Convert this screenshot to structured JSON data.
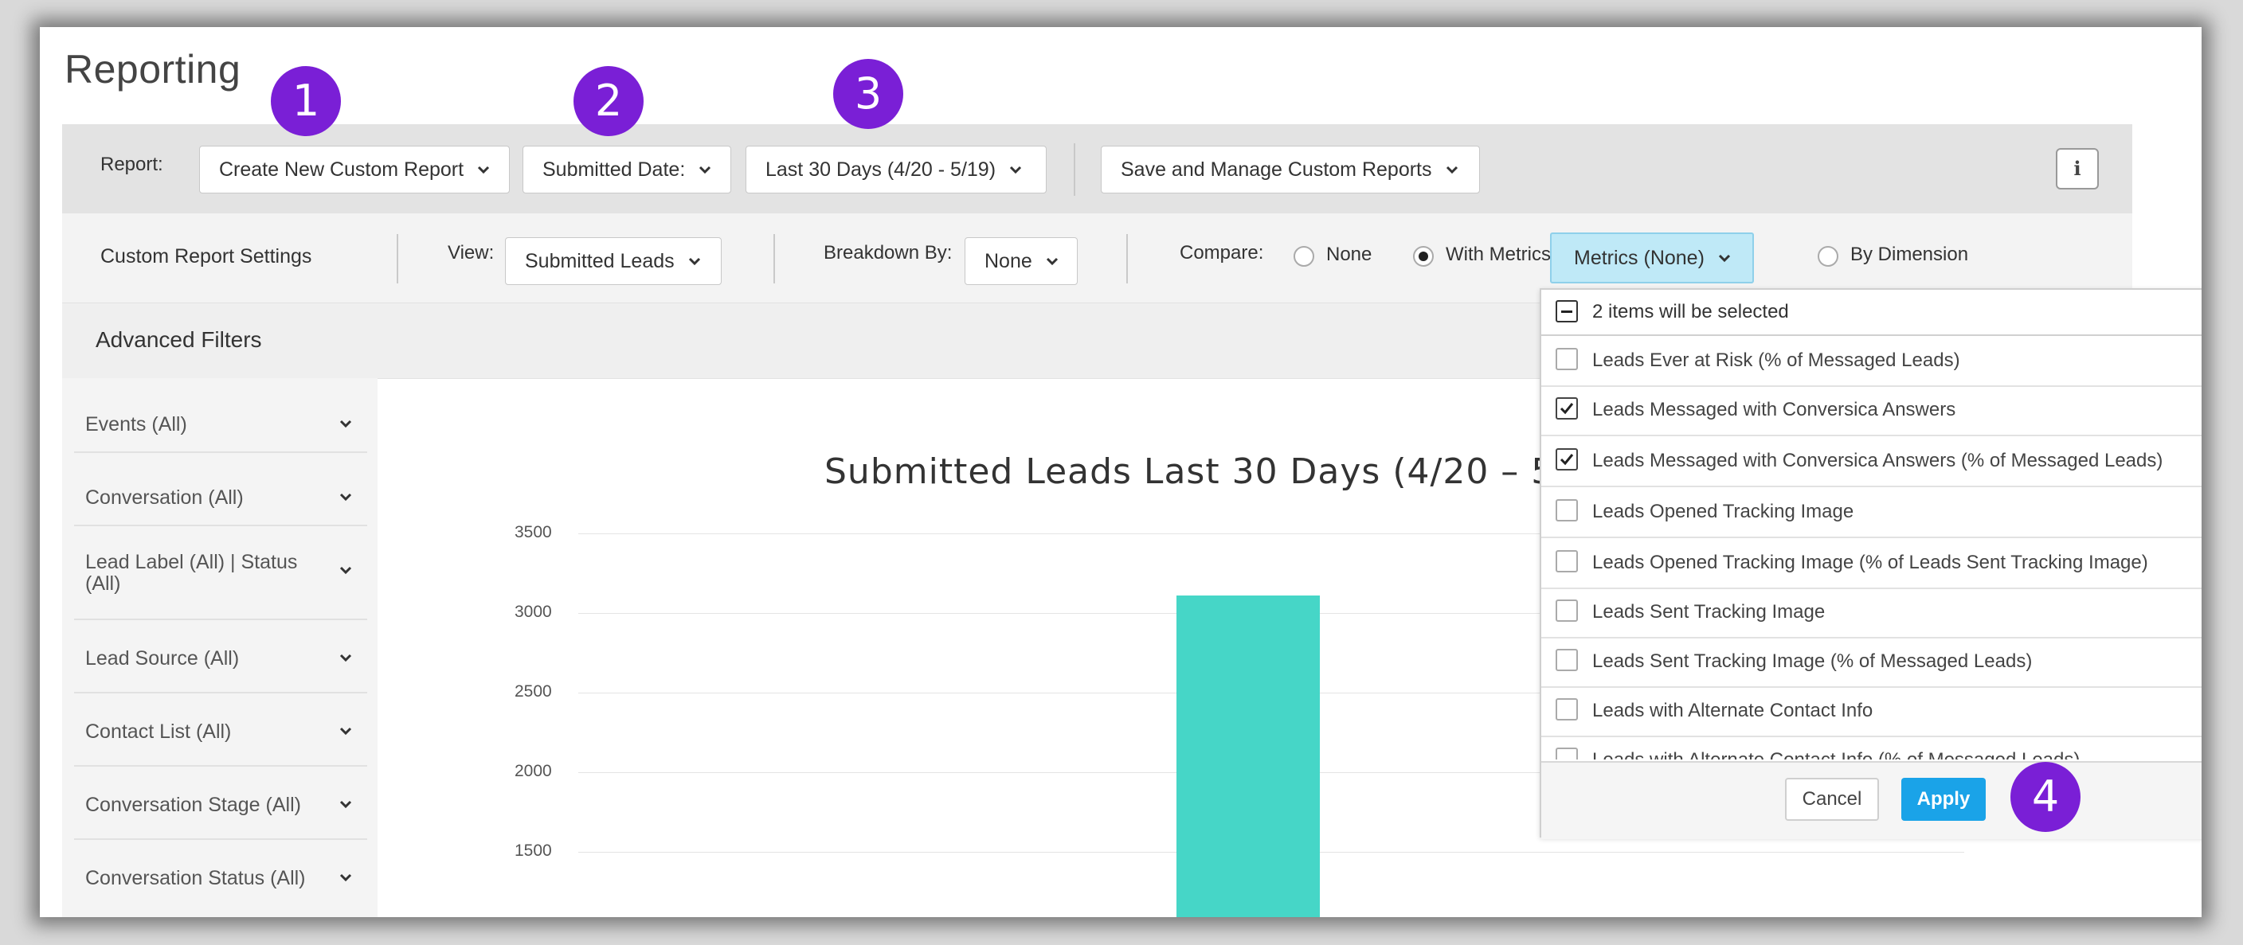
{
  "page": {
    "title": "Reporting"
  },
  "callouts": [
    "1",
    "2",
    "3",
    "4"
  ],
  "toolbar": {
    "report_label": "Report:",
    "report_select": "Create New Custom Report",
    "date_field_select": "Submitted Date:",
    "date_range_select": "Last 30 Days (4/20 - 5/19)",
    "save_manage_button": "Save and Manage Custom Reports",
    "info_icon": "i"
  },
  "settings": {
    "title": "Custom Report Settings",
    "view_label": "View:",
    "view_select": "Submitted Leads",
    "breakdown_label": "Breakdown By:",
    "breakdown_select": "None",
    "compare_label": "Compare:",
    "compare_options": [
      "None",
      "With Metrics",
      "By Dimension"
    ],
    "compare_selected": "With Metrics",
    "metrics_select": "Metrics (None)"
  },
  "filters": {
    "title": "Advanced Filters",
    "items": [
      "Events (All)",
      "Conversation (All)",
      "Lead Label (All) | Status (All)",
      "Lead Source (All)",
      "Contact List (All)",
      "Conversation Stage (All)",
      "Conversation Status (All)"
    ]
  },
  "metrics_dropdown": {
    "header": "2 items will be selected",
    "options": [
      {
        "label": "Leads Ever at Risk (% of Messaged Leads)",
        "checked": false
      },
      {
        "label": "Leads Messaged with Conversica Answers",
        "checked": true
      },
      {
        "label": "Leads Messaged with Conversica Answers (% of Messaged Leads)",
        "checked": true
      },
      {
        "label": "Leads Opened Tracking Image",
        "checked": false
      },
      {
        "label": "Leads Opened Tracking Image (% of Leads Sent Tracking Image)",
        "checked": false
      },
      {
        "label": "Leads Sent Tracking Image",
        "checked": false
      },
      {
        "label": "Leads Sent Tracking Image (% of Messaged Leads)",
        "checked": false
      },
      {
        "label": "Leads with Alternate Contact Info",
        "checked": false
      },
      {
        "label": "Leads with Alternate Contact Info (% of Messaged Leads)",
        "checked": false
      }
    ],
    "cancel": "Cancel",
    "apply": "Apply"
  },
  "chart_data": {
    "type": "bar",
    "title": "Submitted Leads Last 30 Days (4/20 – 5",
    "categories": [
      ""
    ],
    "series": [
      {
        "values": [
          3110
        ]
      }
    ],
    "yticks": [
      "3500",
      "3000",
      "2500",
      "2000",
      "1500"
    ],
    "ylim": [
      1500,
      3500
    ],
    "grid": true,
    "bar_color": "#46d6c7"
  }
}
